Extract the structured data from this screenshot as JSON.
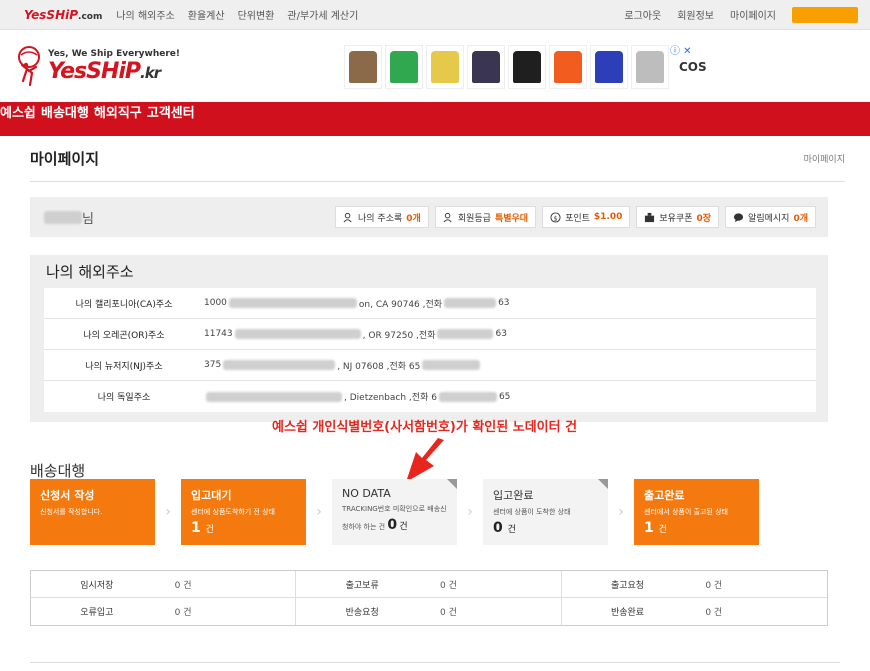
{
  "topbar": {
    "brand": "YesSHiP",
    "brand_suffix": ".com",
    "links_left": [
      "나의 해외주소",
      "환율계산",
      "단위변환",
      "관/부가세 계산기"
    ],
    "links_right": [
      "로그아웃",
      "회원정보",
      "마이페이지"
    ]
  },
  "header": {
    "tagline": "Yes, We Ship Everywhere!",
    "logo_name": "YesSHiP",
    "logo_suffix": ".kr",
    "ad_brand": "COS",
    "ad_shirt_colors": [
      "#8b6a4a",
      "#2fa84f",
      "#e6c94a",
      "#3a3550",
      "#1f1f1f",
      "#f25c1e",
      "#2c3fb8",
      "#bdbdbd"
    ]
  },
  "nav": {
    "items": [
      "예스쉽",
      "배송대행",
      "해외직구",
      "고객센터"
    ]
  },
  "page": {
    "title": "마이페이지",
    "breadcrumb": "마이페이지"
  },
  "user": {
    "name_suffix": "님",
    "chips": [
      {
        "icon": "address-book-icon",
        "label": "나의 주소록",
        "value": "0개"
      },
      {
        "icon": "member-grade-icon",
        "label": "회원등급",
        "value": "특별우대"
      },
      {
        "icon": "point-icon",
        "label": "포인트",
        "value": "$1.00"
      },
      {
        "icon": "coupon-icon",
        "label": "보유쿠폰",
        "value": "0장"
      },
      {
        "icon": "message-icon",
        "label": "알림메시지",
        "value": "0개"
      }
    ]
  },
  "addresses": {
    "title": "나의 해외주소",
    "rows": [
      {
        "label": "나의 캘리포니아(CA)주소",
        "prefix": "1000",
        "mid": "on, CA  90746  ,전화",
        "end": "63"
      },
      {
        "label": "나의 오레곤(OR)주소",
        "prefix": "11743",
        "mid": ", OR  97250  ,전화",
        "end": "63"
      },
      {
        "label": "나의 뉴저지(NJ)주소",
        "prefix": "375",
        "mid": ", NJ  07608  ,전화 65",
        "end": ""
      },
      {
        "label": "나의 독일주소",
        "prefix": "",
        "mid": ", Dietzenbach  ,전화 6",
        "end": "65"
      }
    ]
  },
  "annotation": "예스쉽 개인식별번호(사서함번호)가 확인된 노데이터 건",
  "shipping": {
    "title": "배송대행",
    "steps": [
      {
        "title": "신청서 작성",
        "desc": "신청서를 작성합니다.",
        "count": "",
        "unit": ""
      },
      {
        "title": "입고대기",
        "desc": "센터에 상품도착하기 전 상태",
        "count": "1",
        "unit": "건"
      },
      {
        "title": "NO DATA",
        "desc": "TRACKING번호 미확인으로 배송신청하야 하는 건",
        "count": "0",
        "unit": "건"
      },
      {
        "title": "입고완료",
        "desc": "센터에 상품이 도착한 상태",
        "count": "0",
        "unit": "건"
      },
      {
        "title": "출고완료",
        "desc": "센터에서 상품이 출고된 상태",
        "count": "1",
        "unit": "건"
      }
    ],
    "table": [
      [
        {
          "k": "임시저장",
          "v": "0 건"
        },
        {
          "k": "출고보류",
          "v": "0 건"
        },
        {
          "k": "출고요청",
          "v": "0 건"
        }
      ],
      [
        {
          "k": "오류입고",
          "v": "0 건"
        },
        {
          "k": "반송요청",
          "v": "0 건"
        },
        {
          "k": "반송완료",
          "v": "0 건"
        }
      ]
    ]
  }
}
